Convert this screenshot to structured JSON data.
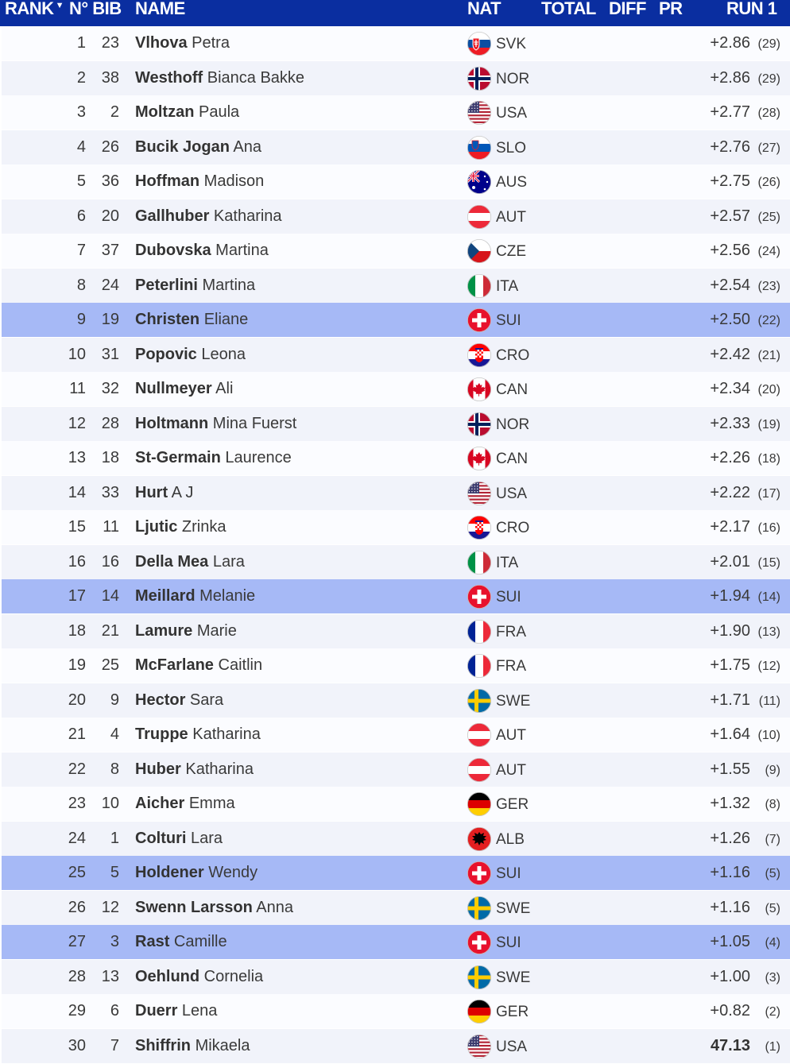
{
  "header": {
    "rank": "RANK",
    "sort_glyph": "▼",
    "bib": "N° BIB",
    "name": "NAME",
    "nat": "NAT",
    "total": "TOTAL",
    "diff": "DIFF",
    "pr": "PR",
    "run": "RUN 1"
  },
  "colors": {
    "header_bg": "#0a2ea0",
    "highlight_row": "#a6b9f6",
    "alt_row": "#f1f3fa"
  },
  "rows": [
    {
      "rank": "1",
      "bib": "23",
      "last": "Vlhova",
      "first": "Petra",
      "nat": "SVK",
      "run": "+2.86",
      "pr": "(29)",
      "highlight": false
    },
    {
      "rank": "2",
      "bib": "38",
      "last": "Westhoff",
      "first": "Bianca Bakke",
      "nat": "NOR",
      "run": "+2.86",
      "pr": "(29)",
      "highlight": false
    },
    {
      "rank": "3",
      "bib": "2",
      "last": "Moltzan",
      "first": "Paula",
      "nat": "USA",
      "run": "+2.77",
      "pr": "(28)",
      "highlight": false
    },
    {
      "rank": "4",
      "bib": "26",
      "last": "Bucik Jogan",
      "first": "Ana",
      "nat": "SLO",
      "run": "+2.76",
      "pr": "(27)",
      "highlight": false
    },
    {
      "rank": "5",
      "bib": "36",
      "last": "Hoffman",
      "first": "Madison",
      "nat": "AUS",
      "run": "+2.75",
      "pr": "(26)",
      "highlight": false
    },
    {
      "rank": "6",
      "bib": "20",
      "last": "Gallhuber",
      "first": "Katharina",
      "nat": "AUT",
      "run": "+2.57",
      "pr": "(25)",
      "highlight": false
    },
    {
      "rank": "7",
      "bib": "37",
      "last": "Dubovska",
      "first": "Martina",
      "nat": "CZE",
      "run": "+2.56",
      "pr": "(24)",
      "highlight": false
    },
    {
      "rank": "8",
      "bib": "24",
      "last": "Peterlini",
      "first": "Martina",
      "nat": "ITA",
      "run": "+2.54",
      "pr": "(23)",
      "highlight": false
    },
    {
      "rank": "9",
      "bib": "19",
      "last": "Christen",
      "first": "Eliane",
      "nat": "SUI",
      "run": "+2.50",
      "pr": "(22)",
      "highlight": true
    },
    {
      "rank": "10",
      "bib": "31",
      "last": "Popovic",
      "first": "Leona",
      "nat": "CRO",
      "run": "+2.42",
      "pr": "(21)",
      "highlight": false
    },
    {
      "rank": "11",
      "bib": "32",
      "last": "Nullmeyer",
      "first": "Ali",
      "nat": "CAN",
      "run": "+2.34",
      "pr": "(20)",
      "highlight": false
    },
    {
      "rank": "12",
      "bib": "28",
      "last": "Holtmann",
      "first": "Mina Fuerst",
      "nat": "NOR",
      "run": "+2.33",
      "pr": "(19)",
      "highlight": false
    },
    {
      "rank": "13",
      "bib": "18",
      "last": "St-Germain",
      "first": "Laurence",
      "nat": "CAN",
      "run": "+2.26",
      "pr": "(18)",
      "highlight": false
    },
    {
      "rank": "14",
      "bib": "33",
      "last": "Hurt",
      "first": "A J",
      "nat": "USA",
      "run": "+2.22",
      "pr": "(17)",
      "highlight": false
    },
    {
      "rank": "15",
      "bib": "11",
      "last": "Ljutic",
      "first": "Zrinka",
      "nat": "CRO",
      "run": "+2.17",
      "pr": "(16)",
      "highlight": false
    },
    {
      "rank": "16",
      "bib": "16",
      "last": "Della Mea",
      "first": "Lara",
      "nat": "ITA",
      "run": "+2.01",
      "pr": "(15)",
      "highlight": false
    },
    {
      "rank": "17",
      "bib": "14",
      "last": "Meillard",
      "first": "Melanie",
      "nat": "SUI",
      "run": "+1.94",
      "pr": "(14)",
      "highlight": true
    },
    {
      "rank": "18",
      "bib": "21",
      "last": "Lamure",
      "first": "Marie",
      "nat": "FRA",
      "run": "+1.90",
      "pr": "(13)",
      "highlight": false
    },
    {
      "rank": "19",
      "bib": "25",
      "last": "McFarlane",
      "first": "Caitlin",
      "nat": "FRA",
      "run": "+1.75",
      "pr": "(12)",
      "highlight": false
    },
    {
      "rank": "20",
      "bib": "9",
      "last": "Hector",
      "first": "Sara",
      "nat": "SWE",
      "run": "+1.71",
      "pr": "(11)",
      "highlight": false
    },
    {
      "rank": "21",
      "bib": "4",
      "last": "Truppe",
      "first": "Katharina",
      "nat": "AUT",
      "run": "+1.64",
      "pr": "(10)",
      "highlight": false
    },
    {
      "rank": "22",
      "bib": "8",
      "last": "Huber",
      "first": "Katharina",
      "nat": "AUT",
      "run": "+1.55",
      "pr": "(9)",
      "highlight": false
    },
    {
      "rank": "23",
      "bib": "10",
      "last": "Aicher",
      "first": "Emma",
      "nat": "GER",
      "run": "+1.32",
      "pr": "(8)",
      "highlight": false
    },
    {
      "rank": "24",
      "bib": "1",
      "last": "Colturi",
      "first": "Lara",
      "nat": "ALB",
      "run": "+1.26",
      "pr": "(7)",
      "highlight": false
    },
    {
      "rank": "25",
      "bib": "5",
      "last": "Holdener",
      "first": "Wendy",
      "nat": "SUI",
      "run": "+1.16",
      "pr": "(5)",
      "highlight": true
    },
    {
      "rank": "26",
      "bib": "12",
      "last": "Swenn Larsson",
      "first": "Anna",
      "nat": "SWE",
      "run": "+1.16",
      "pr": "(5)",
      "highlight": false
    },
    {
      "rank": "27",
      "bib": "3",
      "last": "Rast",
      "first": "Camille",
      "nat": "SUI",
      "run": "+1.05",
      "pr": "(4)",
      "highlight": true
    },
    {
      "rank": "28",
      "bib": "13",
      "last": "Oehlund",
      "first": "Cornelia",
      "nat": "SWE",
      "run": "+1.00",
      "pr": "(3)",
      "highlight": false
    },
    {
      "rank": "29",
      "bib": "6",
      "last": "Duerr",
      "first": "Lena",
      "nat": "GER",
      "run": "+0.82",
      "pr": "(2)",
      "highlight": false
    },
    {
      "rank": "30",
      "bib": "7",
      "last": "Shiffrin",
      "first": "Mikaela",
      "nat": "USA",
      "run": "47.13",
      "pr": "(1)",
      "highlight": false,
      "best": true
    }
  ]
}
